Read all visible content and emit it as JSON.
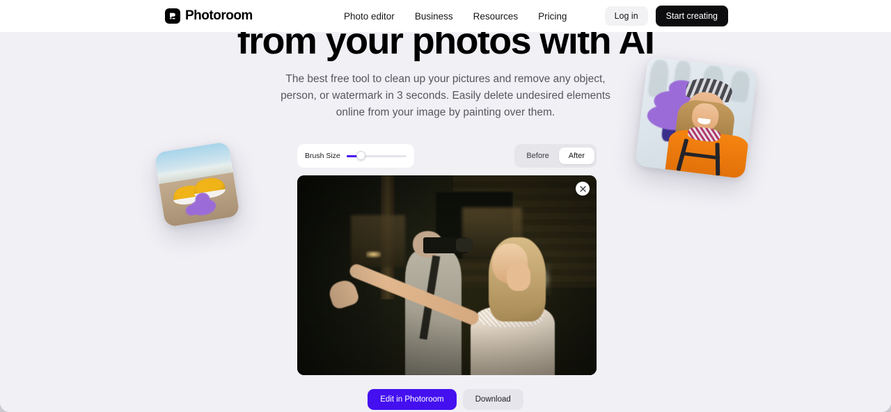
{
  "header": {
    "brand": {
      "name": "Photoroom",
      "logo_icon": "photoroom-logo-icon"
    },
    "nav": [
      {
        "label": "Photo editor"
      },
      {
        "label": "Business"
      },
      {
        "label": "Resources"
      },
      {
        "label": "Pricing"
      }
    ],
    "login_label": "Log in",
    "start_label": "Start creating"
  },
  "hero": {
    "headline": "from your photos with AI",
    "subtitle": "The best free tool to clean up your pictures and remove any object, person, or watermark in 3 seconds. Easily delete undesired elements online from your image by painting over them."
  },
  "editor": {
    "brush": {
      "label": "Brush Size",
      "value": 22,
      "min": 0,
      "max": 100,
      "fill_color": "#4410f0"
    },
    "view_toggle": {
      "options": [
        "Before",
        "After"
      ],
      "selected": "After"
    },
    "close_icon": "close-icon",
    "canvas_alt": "Bride laughing in foreground with a photographer taking a picture in a dark interior"
  },
  "actions": {
    "primary_label": "Edit in Photoroom",
    "primary_color": "#4410f0",
    "secondary_label": "Download"
  },
  "decorations": {
    "left_photo_alt": "Yellow sneakers on a beach with a purple brush stroke over a flip-flop",
    "right_photo_alt": "Smiling woman in an orange jacket with a purple brush stroke over a skier behind her",
    "brush_stroke_color": "#9b6cd8"
  },
  "colors": {
    "header_background": "#ffffff",
    "hero_background": "#f1f0f5",
    "accent": "#4410f0",
    "dark": "#0d0d0f"
  }
}
